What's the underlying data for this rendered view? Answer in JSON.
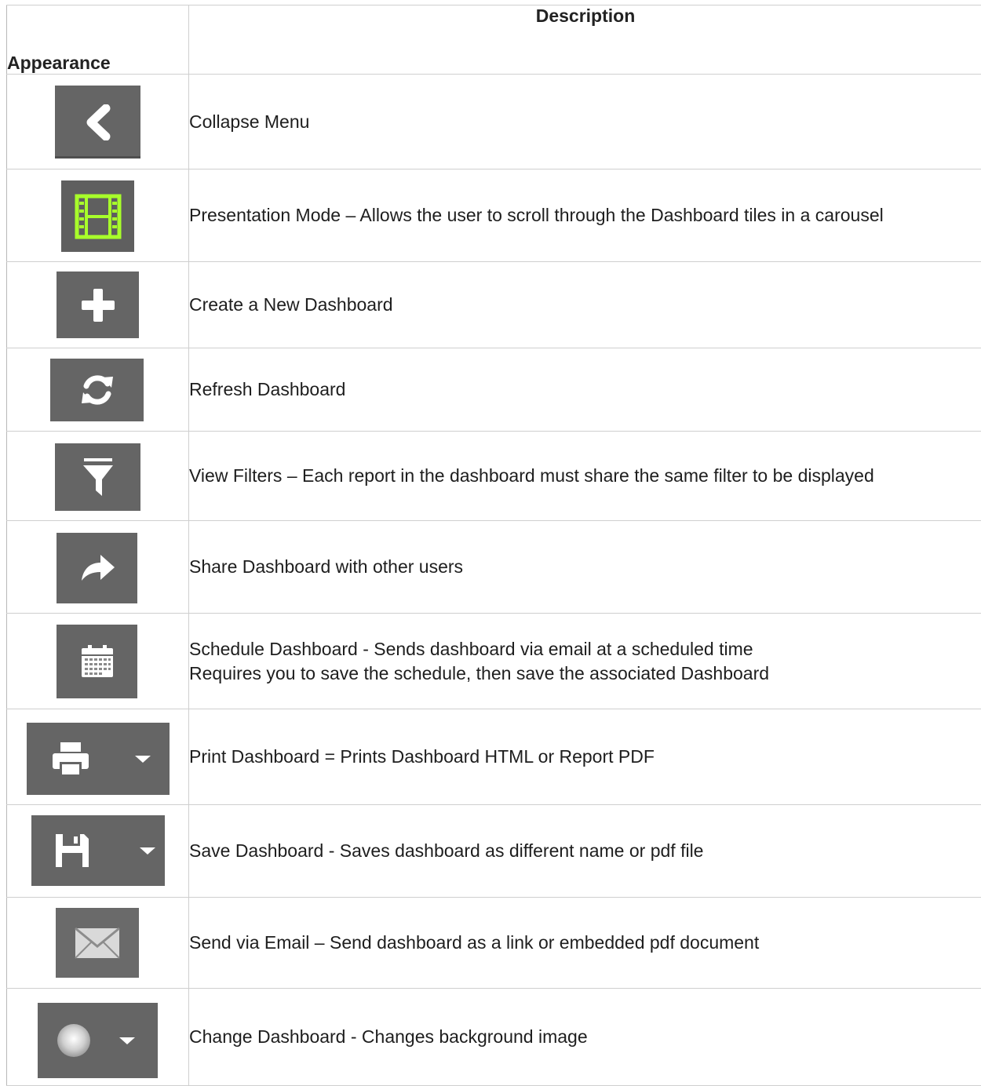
{
  "table": {
    "headers": {
      "appearance": "Appearance",
      "description": "Description"
    },
    "rows": [
      {
        "icon": "collapse-chevron-left-icon",
        "description": "Collapse Menu"
      },
      {
        "icon": "presentation-film-icon",
        "description": "Presentation Mode – Allows the user to scroll through the Dashboard tiles in a carousel"
      },
      {
        "icon": "plus-icon",
        "description": "Create a New Dashboard"
      },
      {
        "icon": "refresh-icon",
        "description": "Refresh Dashboard"
      },
      {
        "icon": "filter-icon",
        "description": "View Filters – Each report in the dashboard must share the same filter to be displayed"
      },
      {
        "icon": "share-arrow-icon",
        "description": "Share Dashboard with other users"
      },
      {
        "icon": "calendar-icon",
        "description": "Schedule Dashboard - Sends dashboard via email at a scheduled time",
        "description_line2": "Requires you to save the schedule, then save the associated Dashboard"
      },
      {
        "icon": "print-icon",
        "description": "Print Dashboard = Prints Dashboard HTML or Report PDF"
      },
      {
        "icon": "save-floppy-icon",
        "description": "Save Dashboard - Saves dashboard as different name or pdf file"
      },
      {
        "icon": "email-envelope-icon",
        "description": "Send via Email – Send dashboard as a link or embedded pdf document"
      },
      {
        "icon": "background-globe-icon",
        "description": "Change Dashboard - Changes background image"
      }
    ]
  },
  "colors": {
    "icon_bg": "#656565",
    "icon_fg": "#ffffff",
    "presentation_accent": "#a8ff2a",
    "border": "#cfcfcf"
  }
}
